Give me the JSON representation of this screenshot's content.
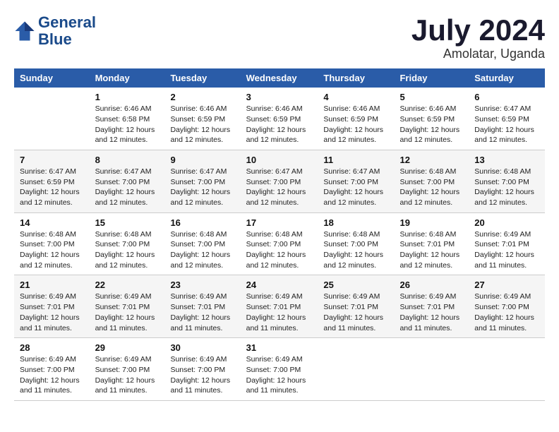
{
  "header": {
    "logo_line1": "General",
    "logo_line2": "Blue",
    "month_year": "July 2024",
    "location": "Amolatar, Uganda"
  },
  "days_of_week": [
    "Sunday",
    "Monday",
    "Tuesday",
    "Wednesday",
    "Thursday",
    "Friday",
    "Saturday"
  ],
  "weeks": [
    [
      {
        "day": "",
        "detail": ""
      },
      {
        "day": "1",
        "detail": "Sunrise: 6:46 AM\nSunset: 6:58 PM\nDaylight: 12 hours\nand 12 minutes."
      },
      {
        "day": "2",
        "detail": "Sunrise: 6:46 AM\nSunset: 6:59 PM\nDaylight: 12 hours\nand 12 minutes."
      },
      {
        "day": "3",
        "detail": "Sunrise: 6:46 AM\nSunset: 6:59 PM\nDaylight: 12 hours\nand 12 minutes."
      },
      {
        "day": "4",
        "detail": "Sunrise: 6:46 AM\nSunset: 6:59 PM\nDaylight: 12 hours\nand 12 minutes."
      },
      {
        "day": "5",
        "detail": "Sunrise: 6:46 AM\nSunset: 6:59 PM\nDaylight: 12 hours\nand 12 minutes."
      },
      {
        "day": "6",
        "detail": "Sunrise: 6:47 AM\nSunset: 6:59 PM\nDaylight: 12 hours\nand 12 minutes."
      }
    ],
    [
      {
        "day": "7",
        "detail": "Sunrise: 6:47 AM\nSunset: 6:59 PM\nDaylight: 12 hours\nand 12 minutes."
      },
      {
        "day": "8",
        "detail": "Sunrise: 6:47 AM\nSunset: 7:00 PM\nDaylight: 12 hours\nand 12 minutes."
      },
      {
        "day": "9",
        "detail": "Sunrise: 6:47 AM\nSunset: 7:00 PM\nDaylight: 12 hours\nand 12 minutes."
      },
      {
        "day": "10",
        "detail": "Sunrise: 6:47 AM\nSunset: 7:00 PM\nDaylight: 12 hours\nand 12 minutes."
      },
      {
        "day": "11",
        "detail": "Sunrise: 6:47 AM\nSunset: 7:00 PM\nDaylight: 12 hours\nand 12 minutes."
      },
      {
        "day": "12",
        "detail": "Sunrise: 6:48 AM\nSunset: 7:00 PM\nDaylight: 12 hours\nand 12 minutes."
      },
      {
        "day": "13",
        "detail": "Sunrise: 6:48 AM\nSunset: 7:00 PM\nDaylight: 12 hours\nand 12 minutes."
      }
    ],
    [
      {
        "day": "14",
        "detail": "Sunrise: 6:48 AM\nSunset: 7:00 PM\nDaylight: 12 hours\nand 12 minutes."
      },
      {
        "day": "15",
        "detail": "Sunrise: 6:48 AM\nSunset: 7:00 PM\nDaylight: 12 hours\nand 12 minutes."
      },
      {
        "day": "16",
        "detail": "Sunrise: 6:48 AM\nSunset: 7:00 PM\nDaylight: 12 hours\nand 12 minutes."
      },
      {
        "day": "17",
        "detail": "Sunrise: 6:48 AM\nSunset: 7:00 PM\nDaylight: 12 hours\nand 12 minutes."
      },
      {
        "day": "18",
        "detail": "Sunrise: 6:48 AM\nSunset: 7:00 PM\nDaylight: 12 hours\nand 12 minutes."
      },
      {
        "day": "19",
        "detail": "Sunrise: 6:48 AM\nSunset: 7:01 PM\nDaylight: 12 hours\nand 12 minutes."
      },
      {
        "day": "20",
        "detail": "Sunrise: 6:49 AM\nSunset: 7:01 PM\nDaylight: 12 hours\nand 11 minutes."
      }
    ],
    [
      {
        "day": "21",
        "detail": "Sunrise: 6:49 AM\nSunset: 7:01 PM\nDaylight: 12 hours\nand 11 minutes."
      },
      {
        "day": "22",
        "detail": "Sunrise: 6:49 AM\nSunset: 7:01 PM\nDaylight: 12 hours\nand 11 minutes."
      },
      {
        "day": "23",
        "detail": "Sunrise: 6:49 AM\nSunset: 7:01 PM\nDaylight: 12 hours\nand 11 minutes."
      },
      {
        "day": "24",
        "detail": "Sunrise: 6:49 AM\nSunset: 7:01 PM\nDaylight: 12 hours\nand 11 minutes."
      },
      {
        "day": "25",
        "detail": "Sunrise: 6:49 AM\nSunset: 7:01 PM\nDaylight: 12 hours\nand 11 minutes."
      },
      {
        "day": "26",
        "detail": "Sunrise: 6:49 AM\nSunset: 7:01 PM\nDaylight: 12 hours\nand 11 minutes."
      },
      {
        "day": "27",
        "detail": "Sunrise: 6:49 AM\nSunset: 7:00 PM\nDaylight: 12 hours\nand 11 minutes."
      }
    ],
    [
      {
        "day": "28",
        "detail": "Sunrise: 6:49 AM\nSunset: 7:00 PM\nDaylight: 12 hours\nand 11 minutes."
      },
      {
        "day": "29",
        "detail": "Sunrise: 6:49 AM\nSunset: 7:00 PM\nDaylight: 12 hours\nand 11 minutes."
      },
      {
        "day": "30",
        "detail": "Sunrise: 6:49 AM\nSunset: 7:00 PM\nDaylight: 12 hours\nand 11 minutes."
      },
      {
        "day": "31",
        "detail": "Sunrise: 6:49 AM\nSunset: 7:00 PM\nDaylight: 12 hours\nand 11 minutes."
      },
      {
        "day": "",
        "detail": ""
      },
      {
        "day": "",
        "detail": ""
      },
      {
        "day": "",
        "detail": ""
      }
    ]
  ]
}
